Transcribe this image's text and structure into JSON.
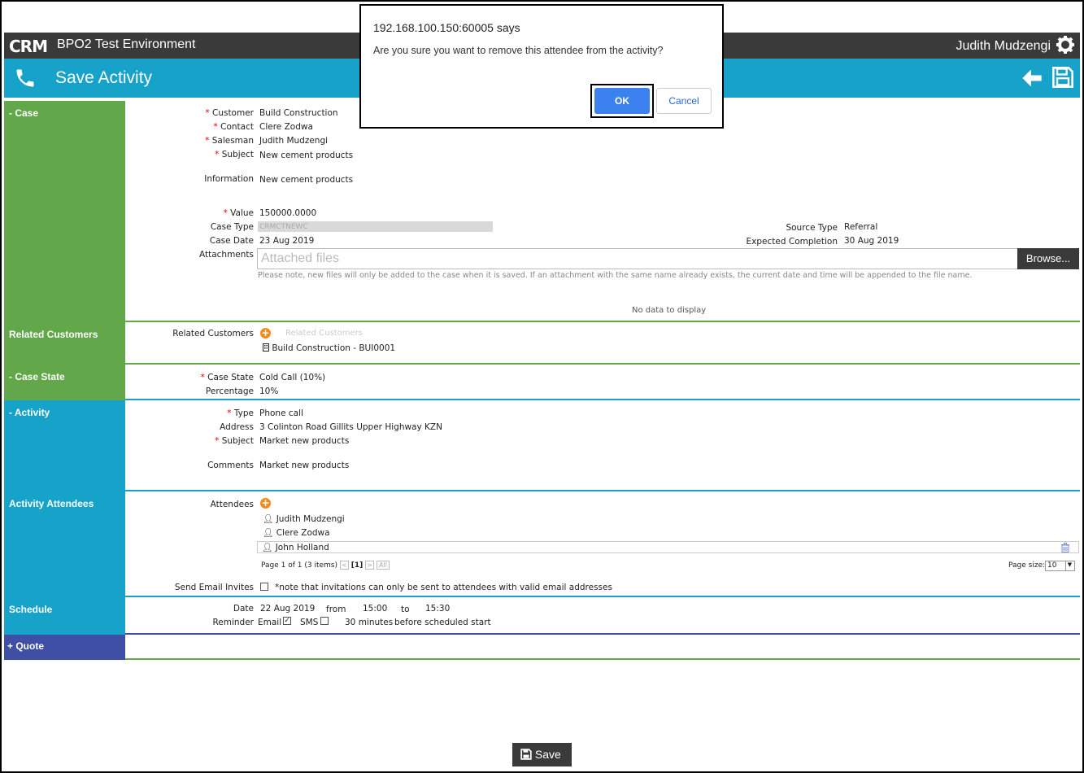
{
  "app": {
    "logo": "CRM",
    "environment": "BPO2 Test Environment",
    "user": "Judith Mudzengi"
  },
  "header": {
    "title": "Save Activity"
  },
  "dialog": {
    "title": "192.168.100.150:60005 says",
    "message": "Are you sure you want to remove this attendee from the activity?",
    "ok": "OK",
    "cancel": "Cancel"
  },
  "case": {
    "section": "- Case",
    "customer_label": "Customer",
    "customer": "Build Construction",
    "contact_label": "Contact",
    "contact": "Clere Zodwa",
    "salesman_label": "Salesman",
    "salesman": "Judith Mudzengi",
    "subject_label": "Subject",
    "subject": "New cement products",
    "information_label": "Information",
    "information": "New cement products",
    "value_label": "Value",
    "value": "150000.0000",
    "case_type_label": "Case Type",
    "case_type": "CRMCTNEWC",
    "source_type_label": "Source Type",
    "source_type": "Referral",
    "case_date_label": "Case Date",
    "case_date": "23 Aug 2019",
    "expected_completion_label": "Expected Completion",
    "expected_completion": "30 Aug 2019",
    "attachments_label": "Attachments",
    "attachments_placeholder": "Attached files",
    "browse": "Browse...",
    "attach_note": "Please note, new files will only be added to the case when it is saved. If an attachment with the same name already exists, the current date and time will be appended to the file name.",
    "no_data": "No data to display"
  },
  "related": {
    "section": "Related Customers",
    "label": "Related Customers",
    "placeholder": "Related Customers",
    "item": "Build Construction - BUI0001"
  },
  "case_state": {
    "section": "- Case State",
    "state_label": "Case State",
    "state": "Cold Call (10%)",
    "percentage_label": "Percentage",
    "percentage": "10%"
  },
  "activity": {
    "section": "- Activity",
    "type_label": "Type",
    "type": "Phone call",
    "address_label": "Address",
    "address": "3 Colinton Road Gillits Upper Highway KZN",
    "subject_label": "Subject",
    "subject": "Market new products",
    "comments_label": "Comments",
    "comments": "Market new products"
  },
  "attendees": {
    "section": "Activity Attendees",
    "label": "Attendees",
    "list": [
      "Judith Mudzengi",
      "Clere Zodwa",
      "John Holland"
    ],
    "pager": "Page 1 of 1 (3 items)",
    "current_page": "[1]",
    "all": "All",
    "page_size_label": "Page size:",
    "page_size": "10",
    "invites_label": "Send Email Invites",
    "invites_note": "*note that invitations can only be sent to attendees with valid email addresses"
  },
  "schedule": {
    "section": "Schedule",
    "date_label": "Date",
    "date": "22 Aug 2019",
    "from_label": "from",
    "from": "15:00",
    "to_label": "to",
    "to": "15:30",
    "reminder_label": "Reminder",
    "email_label": "Email",
    "sms_label": "SMS",
    "minutes": "30 minutes",
    "before": "before scheduled start"
  },
  "quote": {
    "section": "+ Quote"
  },
  "footer": {
    "save": "Save"
  },
  "colors": {
    "green": "#62a84a",
    "blue": "#17a2c9",
    "purple": "#3f4fa5",
    "dark": "#3a3a3a",
    "orange": "#f28a1e"
  }
}
